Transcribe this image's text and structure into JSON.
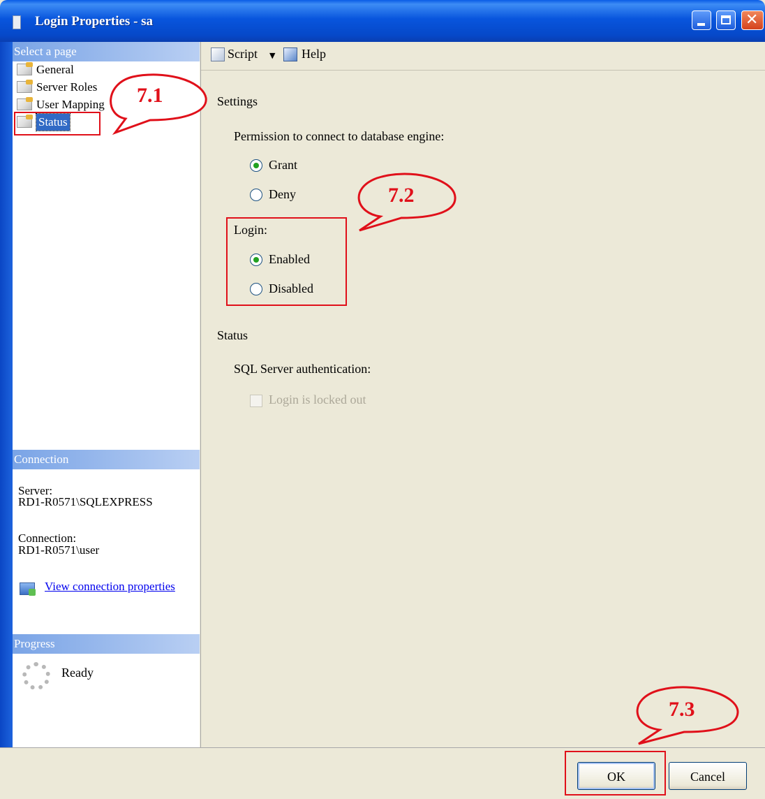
{
  "window": {
    "title": "Login Properties - sa"
  },
  "select_page": {
    "header": "Select a page",
    "items": [
      {
        "label": "General",
        "selected": false
      },
      {
        "label": "Server Roles",
        "selected": false
      },
      {
        "label": "User Mapping",
        "selected": false
      },
      {
        "label": "Status",
        "selected": true
      }
    ]
  },
  "connection": {
    "header": "Connection",
    "server_label": "Server:",
    "server_value": "RD1-R0571\\SQLEXPRESS",
    "connection_label": "Connection:",
    "connection_value": "RD1-R0571\\user",
    "view_link": "View connection properties"
  },
  "progress": {
    "header": "Progress",
    "status": "Ready"
  },
  "toolbar": {
    "script_label": "Script",
    "help_label": "Help"
  },
  "settings": {
    "label": "Settings",
    "permission_label": "Permission to connect to database engine:",
    "grant_label": "Grant",
    "deny_label": "Deny",
    "permission_selected": "Grant",
    "login_label": "Login:",
    "enabled_label": "Enabled",
    "disabled_label": "Disabled",
    "login_selected": "Enabled"
  },
  "status": {
    "label": "Status",
    "sql_auth_label": "SQL Server authentication:",
    "locked_out_label": "Login is locked out",
    "locked_out_checked": false
  },
  "buttons": {
    "ok": "OK",
    "cancel": "Cancel"
  },
  "annotations": {
    "callout_1": "7.1",
    "callout_2": "7.2",
    "callout_3": "7.3",
    "color": "#e0101a"
  }
}
